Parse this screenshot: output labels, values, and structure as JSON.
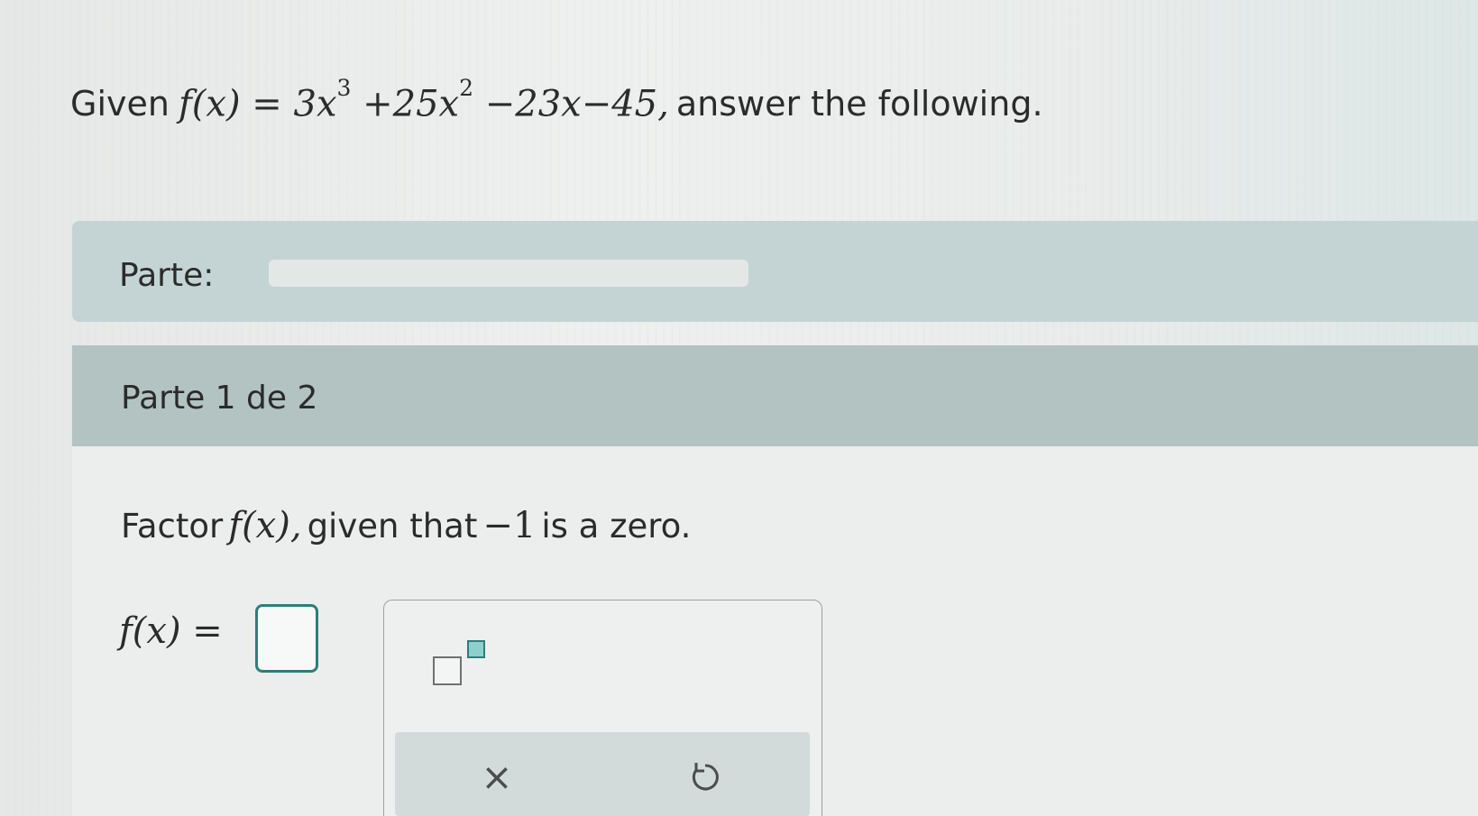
{
  "question": {
    "prefix": "Given",
    "function_lhs": "f(x) = 3x",
    "exp1": "3",
    "term2": "+25x",
    "exp2": "2",
    "rest": "−23x−45,",
    "suffix": "answer the following."
  },
  "parte_bar": {
    "label": "Parte:",
    "progress": 0
  },
  "part": {
    "title": "Parte 1 de 2",
    "instruction_prefix": "Factor",
    "instruction_math": "f(x),",
    "instruction_mid": "given that",
    "instruction_zero": "−1",
    "instruction_suffix": "is a zero.",
    "answer_label": "f(x) =",
    "answer_value": ""
  },
  "palette": {
    "exponent_icon": "superscript-template-icon",
    "clear_symbol": "×",
    "undo_icon": "undo-icon"
  },
  "colors": {
    "accent": "#2f7d7b",
    "parte_bar": "#c4d4d4",
    "header": "#b3c3c1"
  }
}
